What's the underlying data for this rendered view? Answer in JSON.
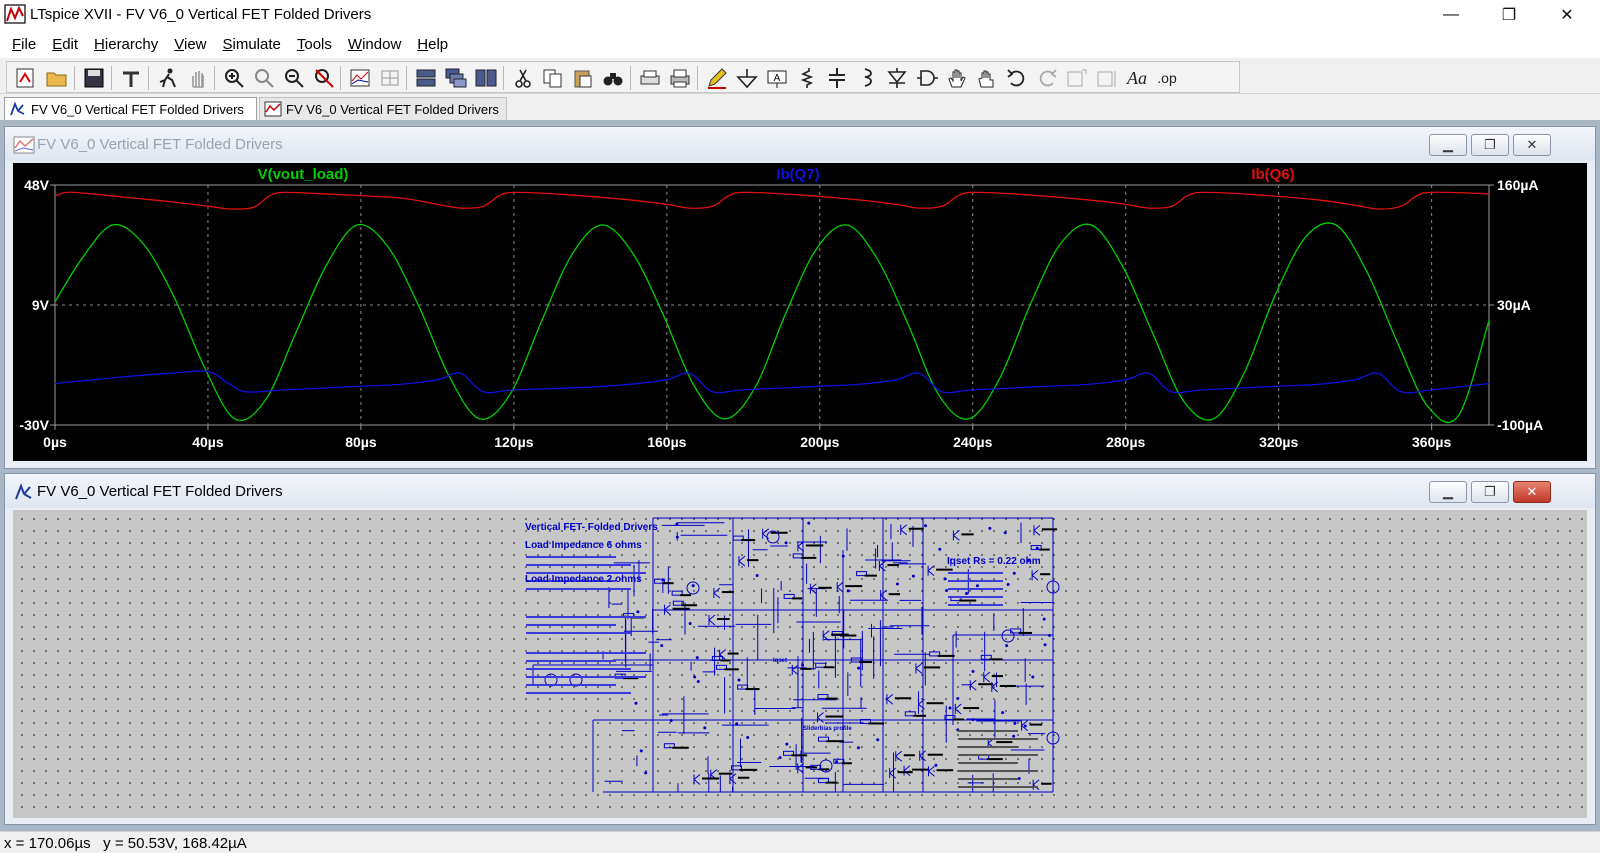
{
  "window": {
    "title": "LTspice XVII - FV V6_0 Vertical FET Folded Drivers",
    "minimize": "—",
    "maximize": "❐",
    "close": "✕"
  },
  "menu": {
    "items": [
      {
        "label": "File",
        "key": "F"
      },
      {
        "label": "Edit",
        "key": "E"
      },
      {
        "label": "Hierarchy",
        "key": "H"
      },
      {
        "label": "View",
        "key": "V"
      },
      {
        "label": "Simulate",
        "key": "S"
      },
      {
        "label": "Tools",
        "key": "T"
      },
      {
        "label": "Window",
        "key": "W"
      },
      {
        "label": "Help",
        "key": "H"
      }
    ]
  },
  "toolbar": {
    "text_tool": "Aa",
    "op_tool": ".op"
  },
  "tabs": [
    {
      "label": "FV V6_0 Vertical FET Folded Drivers",
      "icon": "schematic-icon"
    },
    {
      "label": "FV V6_0 Vertical FET Folded Drivers",
      "icon": "waveform-icon"
    }
  ],
  "plot_window": {
    "title": "FV V6_0 Vertical FET Folded Drivers"
  },
  "schematic_window": {
    "title": "FV V6_0 Vertical FET Folded Drivers"
  },
  "chart_data": {
    "type": "line",
    "background": "#000000",
    "grid": true,
    "x": {
      "label": "",
      "range": [
        0,
        375
      ],
      "ticks": [
        0,
        40,
        80,
        120,
        160,
        200,
        240,
        280,
        320,
        360
      ],
      "tick_labels": [
        "0µs",
        "40µs",
        "80µs",
        "120µs",
        "160µs",
        "200µs",
        "240µs",
        "280µs",
        "320µs",
        "360µs"
      ]
    },
    "y_left": {
      "range": [
        -30,
        48
      ],
      "ticks": [
        -30,
        9,
        48
      ],
      "tick_labels": [
        "-30V",
        "9V",
        "48V"
      ]
    },
    "y_right": {
      "range": [
        -100,
        160
      ],
      "ticks": [
        -100,
        30,
        160
      ],
      "tick_labels": [
        "-100µA",
        "30µA",
        "160µA"
      ]
    },
    "series": [
      {
        "name": "V(vout_load)",
        "color": "#00d000",
        "axis": "left",
        "x": [
          0,
          7,
          15,
          23,
          31,
          39,
          47,
          55,
          63,
          71,
          79,
          87,
          95,
          103,
          111,
          119,
          127,
          135,
          143,
          151,
          159,
          167,
          175,
          183,
          191,
          199,
          207,
          215,
          223,
          231,
          239,
          247,
          255,
          263,
          271,
          279,
          287,
          295,
          303,
          311,
          319,
          327,
          335,
          343,
          351,
          359,
          367,
          375
        ],
        "values": [
          10,
          24,
          35,
          29,
          12,
          -11,
          -28,
          -22,
          0,
          22,
          35,
          28,
          9,
          -14,
          -28,
          -20,
          3,
          25,
          35,
          26,
          6,
          -17,
          -28,
          -18,
          6,
          27,
          35,
          24,
          3,
          -20,
          -28,
          -15,
          9,
          29,
          35,
          22,
          0,
          -22,
          -28,
          -13,
          12,
          31,
          35,
          20,
          -3,
          -24,
          -27,
          4
        ]
      },
      {
        "name": "Ib(Q7)",
        "color": "#1010e0",
        "axis": "right",
        "x": [
          0,
          10,
          20,
          30,
          40,
          45,
          50,
          60,
          80,
          90,
          100,
          106,
          112,
          120,
          140,
          150,
          160,
          166,
          172,
          180,
          200,
          210,
          220,
          226,
          232,
          240,
          260,
          270,
          280,
          286,
          292,
          300,
          320,
          330,
          340,
          346,
          352,
          360,
          375
        ],
        "values": [
          -55,
          -51,
          -47,
          -44,
          -42,
          -54,
          -64,
          -62,
          -58,
          -56,
          -51,
          -44,
          -64,
          -62,
          -59,
          -56,
          -51,
          -44,
          -64,
          -62,
          -58,
          -56,
          -51,
          -44,
          -64,
          -62,
          -58,
          -56,
          -51,
          -44,
          -64,
          -62,
          -58,
          -56,
          -51,
          -44,
          -64,
          -62,
          -55
        ]
      },
      {
        "name": "Ib(Q6)",
        "color": "#e01010",
        "axis": "right",
        "x": [
          0,
          3,
          8,
          20,
          30,
          40,
          46,
          52,
          56,
          60,
          72,
          90,
          100,
          106,
          112,
          116,
          120,
          132,
          150,
          160,
          166,
          172,
          176,
          180,
          192,
          210,
          220,
          226,
          232,
          236,
          240,
          252,
          270,
          280,
          286,
          292,
          296,
          300,
          312,
          330,
          340,
          346,
          352,
          356,
          360,
          372,
          375
        ],
        "values": [
          148,
          152,
          151,
          146,
          142,
          137,
          134,
          136,
          148,
          152,
          150,
          146,
          139,
          135,
          137,
          148,
          152,
          150,
          144,
          139,
          135,
          137,
          148,
          152,
          150,
          144,
          139,
          135,
          137,
          148,
          152,
          150,
          144,
          139,
          135,
          137,
          148,
          152,
          150,
          144,
          138,
          134,
          137,
          148,
          152,
          151,
          150
        ]
      }
    ],
    "legend_placement": "top"
  },
  "schematic_text": {
    "title": "Vertical FET- Folded Drivers",
    "load6": "Load Impedance 6 ohms",
    "load2": "Load Impedance 2 ohms",
    "iqset": "Iqset Rs = 0.22 ohm",
    "iqset_label": "Iqset",
    "bias_note": "Sliderbias profile"
  },
  "status": {
    "x_label": "x = ",
    "x_value": "170.06µs",
    "y_label": "y = ",
    "y_value": "50.53V, 168.42µA"
  }
}
